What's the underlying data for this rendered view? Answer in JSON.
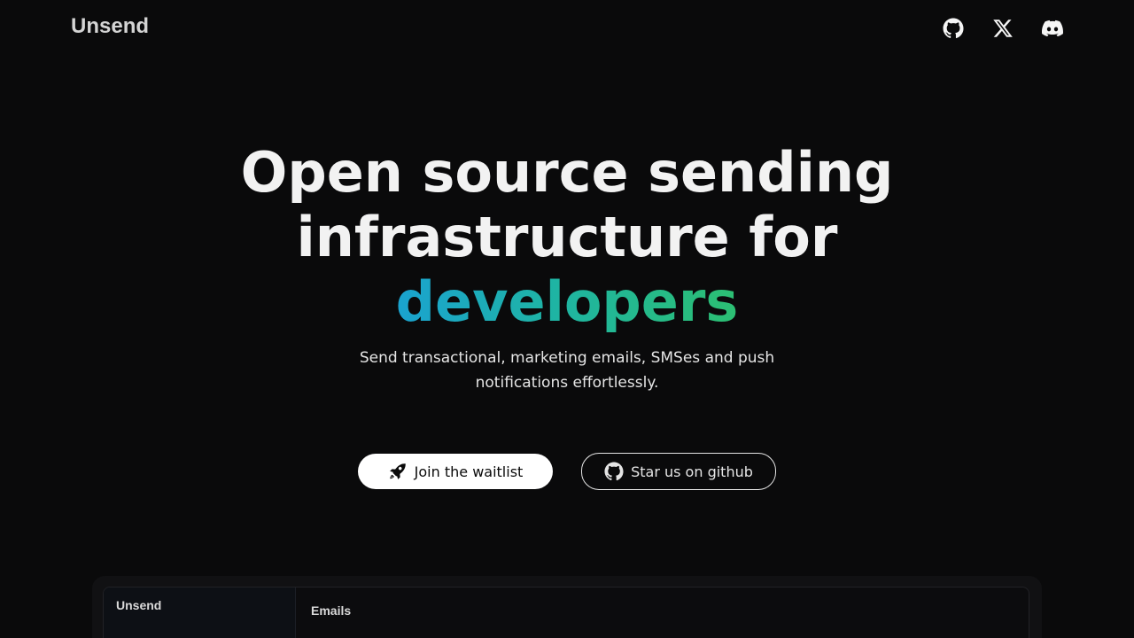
{
  "header": {
    "brand": "Unsend",
    "social": [
      {
        "name": "github",
        "icon": "github-icon"
      },
      {
        "name": "x",
        "icon": "x-icon"
      },
      {
        "name": "discord",
        "icon": "discord-icon"
      }
    ]
  },
  "hero": {
    "title_line1": "Open source sending",
    "title_line2": "infrastructure for",
    "title_highlight": "developers",
    "subtitle_line1": "Send transactional, marketing emails, SMSes and push",
    "subtitle_line2": "notifications effortlessly."
  },
  "actions": {
    "primary_label": "Join the waitlist",
    "primary_icon": "rocket-icon",
    "secondary_label": "Star us on github",
    "secondary_icon": "github-icon"
  },
  "preview": {
    "brand": "Unsend",
    "heading": "Emails"
  },
  "colors": {
    "background": "#0a0a0b",
    "gradient_start": "#1aa3d0",
    "gradient_end": "#2cbf72"
  }
}
